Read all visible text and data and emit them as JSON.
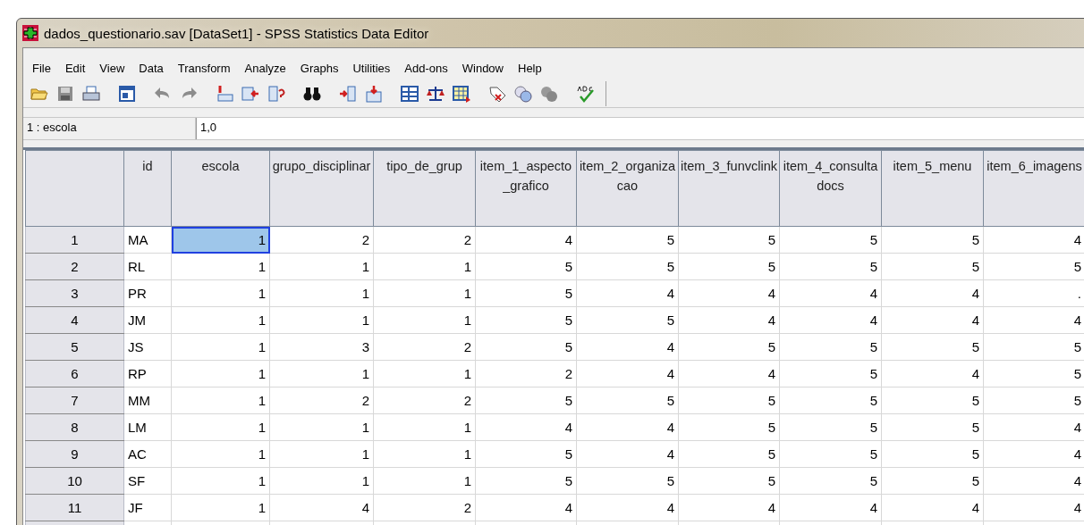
{
  "window": {
    "title": "dados_questionario.sav [DataSet1] - SPSS Statistics Data Editor"
  },
  "menu": [
    "File",
    "Edit",
    "View",
    "Data",
    "Transform",
    "Analyze",
    "Graphs",
    "Utilities",
    "Add-ons",
    "Window",
    "Help"
  ],
  "cell_editor": {
    "reference": "1 : escola",
    "value": "1,0"
  },
  "table": {
    "columns": [
      "id",
      "escola",
      "grupo_disciplinar",
      "tipo_de_grup",
      "item_1_aspecto_grafico",
      "item_2_organizacao",
      "item_3_funvclink",
      "item_4_consultadocs",
      "item_5_menu",
      "item_6_imagens"
    ],
    "rows": [
      {
        "number": "1",
        "cells": [
          {
            "value": "MA",
            "selected": false
          },
          {
            "value": "1",
            "selected": true
          },
          {
            "value": "2",
            "selected": false
          },
          {
            "value": "2",
            "selected": false
          },
          {
            "value": "4",
            "selected": false
          },
          {
            "value": "5",
            "selected": false
          },
          {
            "value": "5",
            "selected": false
          },
          {
            "value": "5",
            "selected": false
          },
          {
            "value": "5",
            "selected": false
          },
          {
            "value": "4",
            "selected": false
          }
        ]
      },
      {
        "number": "2",
        "cells": [
          {
            "value": "RL",
            "selected": false
          },
          {
            "value": "1",
            "selected": false
          },
          {
            "value": "1",
            "selected": false
          },
          {
            "value": "1",
            "selected": false
          },
          {
            "value": "5",
            "selected": false
          },
          {
            "value": "5",
            "selected": false
          },
          {
            "value": "5",
            "selected": false
          },
          {
            "value": "5",
            "selected": false
          },
          {
            "value": "5",
            "selected": false
          },
          {
            "value": "5",
            "selected": false
          }
        ]
      },
      {
        "number": "3",
        "cells": [
          {
            "value": "PR",
            "selected": false
          },
          {
            "value": "1",
            "selected": false
          },
          {
            "value": "1",
            "selected": false
          },
          {
            "value": "1",
            "selected": false
          },
          {
            "value": "5",
            "selected": false
          },
          {
            "value": "4",
            "selected": false
          },
          {
            "value": "4",
            "selected": false
          },
          {
            "value": "4",
            "selected": false
          },
          {
            "value": "4",
            "selected": false
          },
          {
            "value": ".",
            "selected": false
          }
        ]
      },
      {
        "number": "4",
        "cells": [
          {
            "value": "JM",
            "selected": false
          },
          {
            "value": "1",
            "selected": false
          },
          {
            "value": "1",
            "selected": false
          },
          {
            "value": "1",
            "selected": false
          },
          {
            "value": "5",
            "selected": false
          },
          {
            "value": "5",
            "selected": false
          },
          {
            "value": "4",
            "selected": false
          },
          {
            "value": "4",
            "selected": false
          },
          {
            "value": "4",
            "selected": false
          },
          {
            "value": "4",
            "selected": false
          }
        ]
      },
      {
        "number": "5",
        "cells": [
          {
            "value": "JS",
            "selected": false
          },
          {
            "value": "1",
            "selected": false
          },
          {
            "value": "3",
            "selected": false
          },
          {
            "value": "2",
            "selected": false
          },
          {
            "value": "5",
            "selected": false
          },
          {
            "value": "4",
            "selected": false
          },
          {
            "value": "5",
            "selected": false
          },
          {
            "value": "5",
            "selected": false
          },
          {
            "value": "5",
            "selected": false
          },
          {
            "value": "5",
            "selected": false
          }
        ]
      },
      {
        "number": "6",
        "cells": [
          {
            "value": "RP",
            "selected": false
          },
          {
            "value": "1",
            "selected": false
          },
          {
            "value": "1",
            "selected": false
          },
          {
            "value": "1",
            "selected": false
          },
          {
            "value": "2",
            "selected": false
          },
          {
            "value": "4",
            "selected": false
          },
          {
            "value": "4",
            "selected": false
          },
          {
            "value": "5",
            "selected": false
          },
          {
            "value": "4",
            "selected": false
          },
          {
            "value": "5",
            "selected": false
          }
        ]
      },
      {
        "number": "7",
        "cells": [
          {
            "value": "MM",
            "selected": false
          },
          {
            "value": "1",
            "selected": false
          },
          {
            "value": "2",
            "selected": false
          },
          {
            "value": "2",
            "selected": false
          },
          {
            "value": "5",
            "selected": false
          },
          {
            "value": "5",
            "selected": false
          },
          {
            "value": "5",
            "selected": false
          },
          {
            "value": "5",
            "selected": false
          },
          {
            "value": "5",
            "selected": false
          },
          {
            "value": "5",
            "selected": false
          }
        ]
      },
      {
        "number": "8",
        "cells": [
          {
            "value": "LM",
            "selected": false
          },
          {
            "value": "1",
            "selected": false
          },
          {
            "value": "1",
            "selected": false
          },
          {
            "value": "1",
            "selected": false
          },
          {
            "value": "4",
            "selected": false
          },
          {
            "value": "4",
            "selected": false
          },
          {
            "value": "5",
            "selected": false
          },
          {
            "value": "5",
            "selected": false
          },
          {
            "value": "5",
            "selected": false
          },
          {
            "value": "4",
            "selected": false
          }
        ]
      },
      {
        "number": "9",
        "cells": [
          {
            "value": "AC",
            "selected": false
          },
          {
            "value": "1",
            "selected": false
          },
          {
            "value": "1",
            "selected": false
          },
          {
            "value": "1",
            "selected": false
          },
          {
            "value": "5",
            "selected": false
          },
          {
            "value": "4",
            "selected": false
          },
          {
            "value": "5",
            "selected": false
          },
          {
            "value": "5",
            "selected": false
          },
          {
            "value": "5",
            "selected": false
          },
          {
            "value": "4",
            "selected": false
          }
        ]
      },
      {
        "number": "10",
        "cells": [
          {
            "value": "SF",
            "selected": false
          },
          {
            "value": "1",
            "selected": false
          },
          {
            "value": "1",
            "selected": false
          },
          {
            "value": "1",
            "selected": false
          },
          {
            "value": "5",
            "selected": false
          },
          {
            "value": "5",
            "selected": false
          },
          {
            "value": "5",
            "selected": false
          },
          {
            "value": "5",
            "selected": false
          },
          {
            "value": "5",
            "selected": false
          },
          {
            "value": "4",
            "selected": false
          }
        ]
      },
      {
        "number": "11",
        "cells": [
          {
            "value": "JF",
            "selected": false
          },
          {
            "value": "1",
            "selected": false
          },
          {
            "value": "4",
            "selected": false
          },
          {
            "value": "2",
            "selected": false
          },
          {
            "value": "4",
            "selected": false
          },
          {
            "value": "4",
            "selected": false
          },
          {
            "value": "4",
            "selected": false
          },
          {
            "value": "4",
            "selected": false
          },
          {
            "value": "4",
            "selected": false
          },
          {
            "value": "4",
            "selected": false
          }
        ]
      }
    ]
  }
}
